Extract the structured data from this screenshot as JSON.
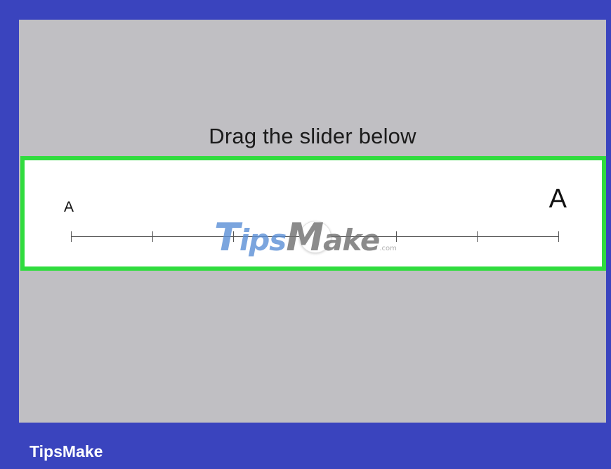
{
  "instruction": "Drag the slider below",
  "text_size_slider": {
    "min_label": "A",
    "max_label": "A",
    "tick_count": 7,
    "value_step": 3
  },
  "watermark": {
    "part1": "T",
    "part2": "ips",
    "part3": "M",
    "part4": "ake",
    "suffix": ".com"
  },
  "brand": "TipsMake",
  "colors": {
    "frame": "#3a44be",
    "screen": "#c0bfc3",
    "highlight": "#30dc3e",
    "panel": "#ffffff"
  }
}
